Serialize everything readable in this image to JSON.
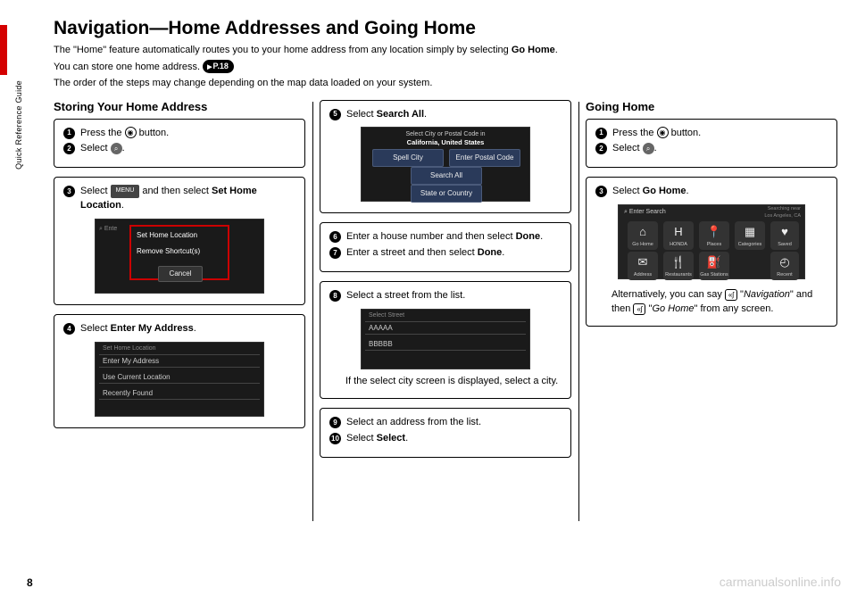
{
  "sideLabel": "Quick Reference Guide",
  "pageNumber": "8",
  "watermark": "carmanualsonline.info",
  "title": "Navigation—Home Addresses and Going Home",
  "intro": {
    "line1a": "The \"Home\" feature automatically routes you to your home address from any location simply by selecting ",
    "line1b": "Go Home",
    "line1c": ".",
    "line2a": "You can store one home address. ",
    "line2ref": "P.18",
    "line3": "The order of the steps may change depending on the map data loaded on your system."
  },
  "col1": {
    "heading": "Storing Your Home Address",
    "box1": {
      "s1a": "Press the ",
      "s1b": " button.",
      "s2a": "Select ",
      "s2b": "."
    },
    "box2": {
      "s3a": "Select ",
      "s3menu": "MENU",
      "s3b": " and then select ",
      "s3c": "Set Home Location",
      "s3d": ".",
      "scTop": "Set Home Location",
      "scMid": "Remove Shortcut(s)",
      "scCancel": "Cancel"
    },
    "box3": {
      "s4a": "Select ",
      "s4b": "Enter My Address",
      "s4c": ".",
      "scHead": "Set Home Location",
      "scR1": "Enter My Address",
      "scR2": "Use Current Location",
      "scR3": "Recently Found"
    }
  },
  "col2": {
    "box1": {
      "s5a": "Select ",
      "s5b": "Search All",
      "s5c": ".",
      "scHead1": "Select City or Postal Code in",
      "scHead2": "California, United States",
      "scB1": "Spell City",
      "scB2": "Enter Postal Code",
      "scB3": "Search All",
      "scB4": "State or Country"
    },
    "box2": {
      "s6a": "Enter a house number and then select ",
      "s6b": "Done",
      "s6c": ".",
      "s7a": "Enter a street and then select ",
      "s7b": "Done",
      "s7c": "."
    },
    "box3": {
      "s8a": "Select a street from the list.",
      "scHead": "Select Street",
      "scR1": "AAAAA",
      "scR2": "BBBBB",
      "note": "If the select city screen is displayed, select a city."
    },
    "box4": {
      "s9a": "Select an address from the list.",
      "s10a": "Select ",
      "s10b": "Select",
      "s10c": "."
    }
  },
  "col3": {
    "heading": "Going Home",
    "box1": {
      "s1a": "Press the ",
      "s1b": " button.",
      "s2a": "Select ",
      "s2b": "."
    },
    "box2": {
      "s3a": "Select ",
      "s3b": "Go Home",
      "s3c": ".",
      "scSearch": "Enter Search",
      "scLoc": "Searching near\nLos Angeles, CA",
      "tiles": [
        "Go Home",
        "HONDA",
        "Places",
        "Categories",
        "Address",
        "Restaurants",
        "Gas Stations",
        "Saved",
        "Recent"
      ],
      "noteA": "Alternatively, you can say ",
      "noteB": " \"",
      "noteC": "Navigation",
      "noteD": "\" and then ",
      "noteE": " \"",
      "noteF": "Go Home",
      "noteG": "\" from any screen."
    }
  }
}
